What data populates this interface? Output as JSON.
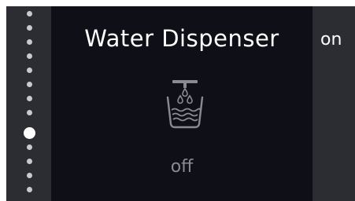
{
  "page_indicator": {
    "total": 13,
    "active_index": 8
  },
  "main": {
    "title": "Water Dispenser",
    "state_label": "off",
    "icon": "water-dispenser-icon"
  },
  "next_panel": {
    "label": "on"
  },
  "colors": {
    "background": "#2c2c33",
    "main_panel": "#0f0f17",
    "text_primary": "#ffffff",
    "text_muted": "#8a8a92",
    "dot_inactive": "#c9c9cf",
    "dot_active": "#ffffff"
  }
}
